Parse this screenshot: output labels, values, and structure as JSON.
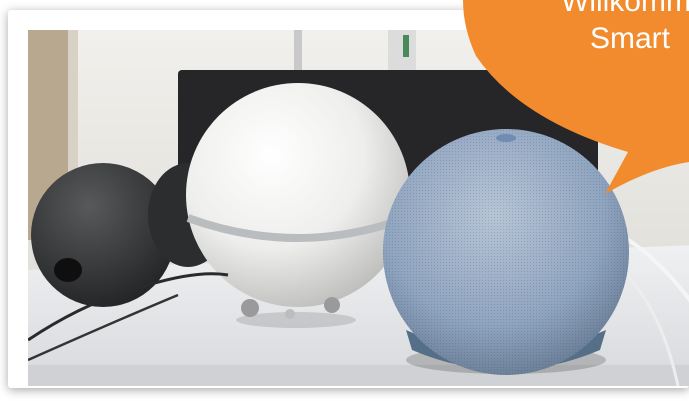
{
  "bubble": {
    "lines": [
      "Willkommen",
      "Smart"
    ],
    "color": "#f28b2e",
    "text_color": "#ffffff"
  },
  "photo": {
    "subjects": [
      "white-spherical-speaker",
      "blue-fabric-smart-speaker",
      "black-device",
      "dark-monitor"
    ],
    "palette": {
      "wall": "#ece9e4",
      "table": "#e6e7e9",
      "white_sphere": "#f3f3f1",
      "blue_speaker": "#8fa4bf",
      "blue_speaker_base": "#5f7893",
      "black_device": "#2b2b2c"
    }
  }
}
